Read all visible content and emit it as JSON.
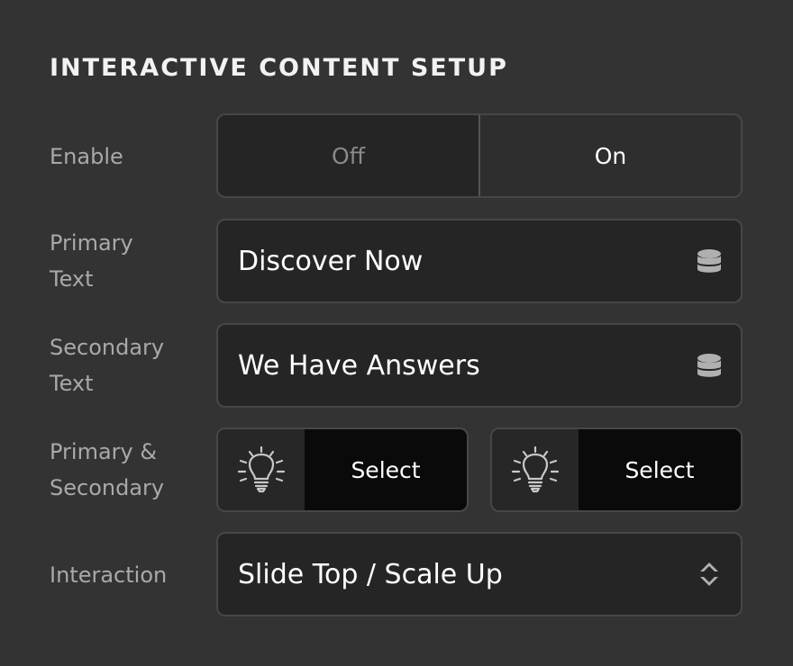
{
  "panel": {
    "title": "INTERACTIVE CONTENT SETUP"
  },
  "enable": {
    "label": "Enable",
    "options": [
      "Off",
      "On"
    ],
    "selected": "On"
  },
  "primary_text": {
    "label_line1": "Primary",
    "label_line2": "Text",
    "value": "Discover Now",
    "icon": "database-icon"
  },
  "secondary_text": {
    "label_line1": "Secondary",
    "label_line2": "Text",
    "value": "We Have Answers",
    "icon": "database-icon"
  },
  "primary_secondary": {
    "label_line1": "Primary &",
    "label_line2": "Secondary",
    "buttons": [
      {
        "label": "Select",
        "icon": "lightbulb-icon"
      },
      {
        "label": "Select",
        "icon": "lightbulb-icon"
      }
    ]
  },
  "interaction": {
    "label": "Interaction",
    "value": "Slide Top / Scale Up",
    "icon": "up-down-arrows-icon"
  },
  "colors": {
    "background": "#333333",
    "field_background": "#252525",
    "select_background": "#0a0a0a",
    "label_text": "#a9a9a9",
    "icon_gray": "#b0b0b0"
  }
}
